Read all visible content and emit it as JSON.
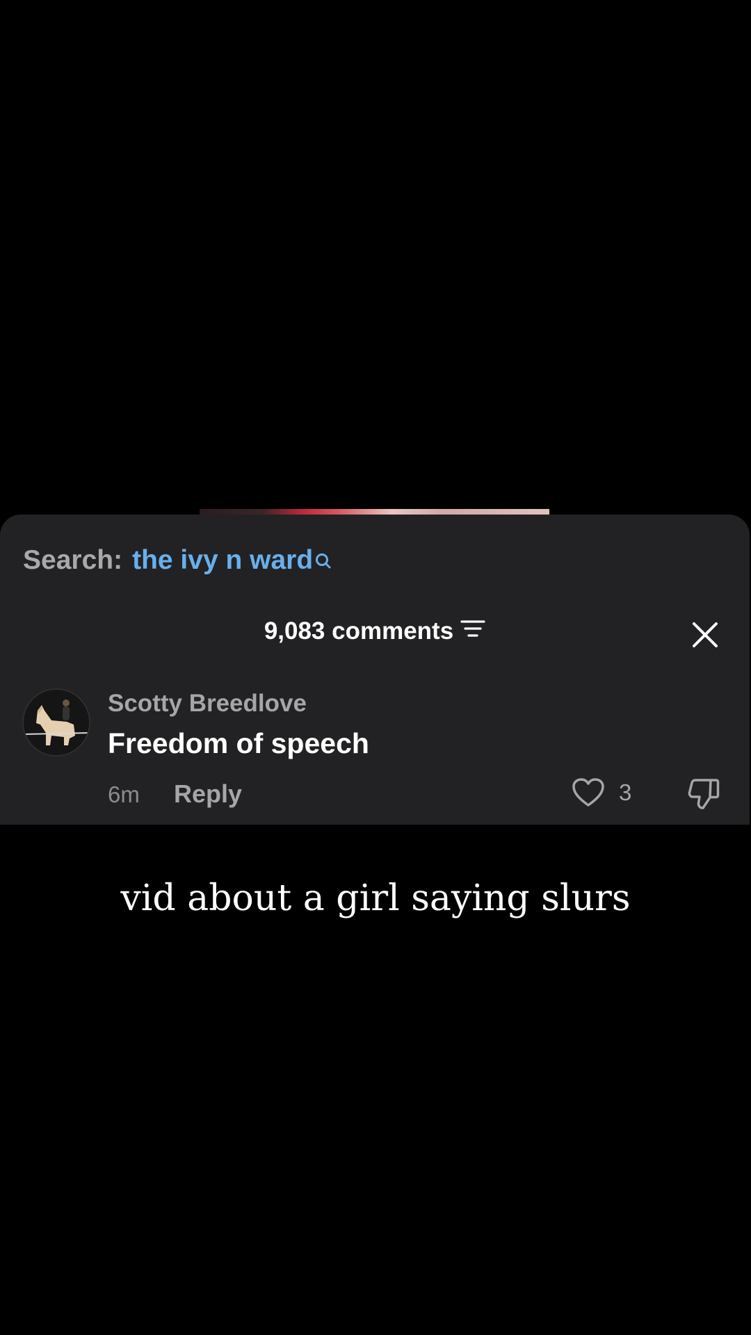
{
  "search": {
    "prefix": "Search:",
    "query": "the ivy n ward"
  },
  "comments_header": {
    "count_label": "9,083 comments"
  },
  "comment": {
    "username": "Scotty Breedlove",
    "text": "Freedom of speech",
    "time": "6m",
    "reply_label": "Reply",
    "likes": "3"
  },
  "caption": "vid about a girl saying slurs",
  "colors": {
    "sheet_bg": "#222224",
    "search_query": "#68b0ec",
    "muted_text": "#a6a6a8",
    "primary_text": "#ffffff"
  }
}
